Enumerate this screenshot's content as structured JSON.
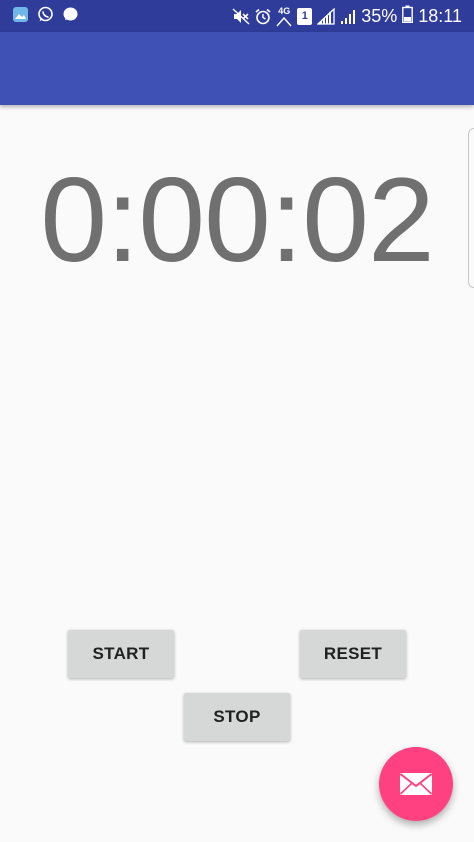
{
  "status_bar": {
    "battery_percent": "35%",
    "time": "18:11",
    "network_label": "4G",
    "sim_badge": "1",
    "left_icons": [
      "gallery-icon",
      "whatsapp-icon",
      "chat-bubble-icon"
    ],
    "right_icons": [
      "mute-icon",
      "alarm-icon",
      "network-4g-icon",
      "sim-1-icon",
      "signal-icon",
      "signal-icon",
      "battery-icon"
    ]
  },
  "app_bar": {
    "title": ""
  },
  "timer": {
    "display": "0:00:02"
  },
  "buttons": {
    "start_label": "START",
    "reset_label": "RESET",
    "stop_label": "STOP"
  },
  "fab": {
    "icon": "mail-icon"
  },
  "colors": {
    "status_bar": "#2f3c9a",
    "app_bar": "#3f51b5",
    "background": "#fafafa",
    "timer_text": "#707070",
    "button": "#d6d7d7",
    "fab": "#ff4081"
  }
}
